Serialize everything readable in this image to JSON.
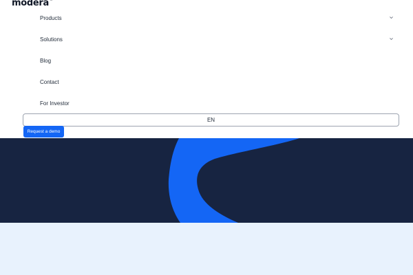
{
  "brand": {
    "name": "modera",
    "mark": "®"
  },
  "nav": {
    "items": [
      {
        "label": "Products",
        "has_dropdown": true
      },
      {
        "label": "Solutions",
        "has_dropdown": true
      },
      {
        "label": "Blog",
        "has_dropdown": false
      },
      {
        "label": "Contact",
        "has_dropdown": false
      },
      {
        "label": "For Investor",
        "has_dropdown": false
      }
    ]
  },
  "language": {
    "selected": "EN"
  },
  "cta": {
    "label": "Request a demo"
  },
  "colors": {
    "accent": "#1466f5",
    "hero_background": "#172441",
    "lower_background": "#e8f2fd"
  }
}
